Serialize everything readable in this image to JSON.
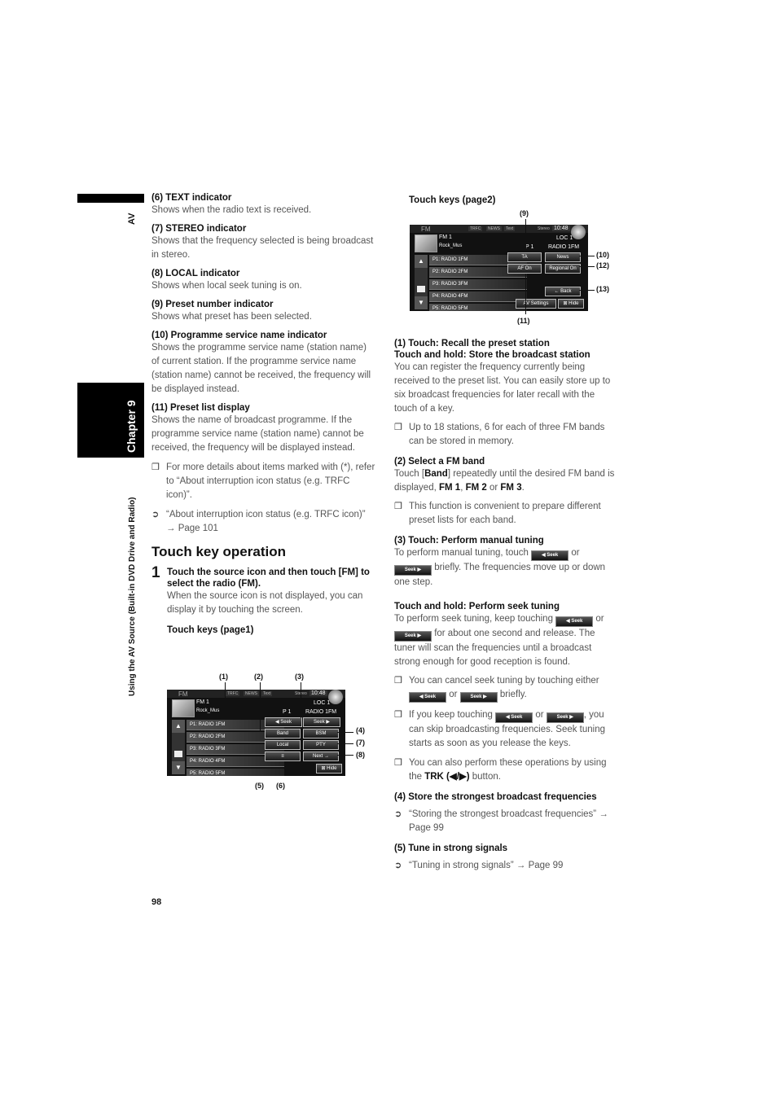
{
  "side": {
    "section_tab": "AV",
    "chapter": "Chapter 9",
    "running_title": "Using the AV Source (Built-in DVD Drive and Radio)"
  },
  "left": {
    "items": [
      {
        "heading": "(6) TEXT indicator",
        "body": "Shows when the radio text is received."
      },
      {
        "heading": "(7) STEREO indicator",
        "body": "Shows that the frequency selected is being broadcast in stereo."
      },
      {
        "heading": "(8) LOCAL indicator",
        "body": "Shows when local seek tuning is on."
      },
      {
        "heading": "(9) Preset number indicator",
        "body": "Shows what preset has been selected."
      },
      {
        "heading": "(10) Programme service name indicator",
        "body": "Shows the programme service name (station name) of current station. If the programme service name (station name) cannot be received, the frequency will be displayed instead."
      },
      {
        "heading": "(11) Preset list display",
        "body": "Shows the name of broadcast programme. If the programme service name (station name) cannot be received, the frequency will be displayed instead."
      }
    ],
    "note1": "For more details about items marked with (*), refer to “About interruption icon status (e.g. TRFC icon)”.",
    "ref1": "“About interruption icon status (e.g. TRFC icon)” → Page 101",
    "section_title": "Touch key operation",
    "step_num": "1",
    "step_heading": "Touch the source icon and then touch [FM] to select the radio (FM).",
    "step_body": "When the source icon is not displayed, you can display it by touching the screen.",
    "page1_label": "Touch keys (page1)"
  },
  "screen": {
    "source": "FM",
    "indicators": [
      "TRFC",
      "NEWS",
      "Text"
    ],
    "stereo": "Stereo",
    "clock": "10:48",
    "band": "FM 1",
    "ps_left": "Rock_Mus",
    "loc": "LOC 1",
    "preset_no": "P 1",
    "ps_name": "RADIO 1FM",
    "presets": [
      "P1: RADIO 1FM",
      "P2: RADIO 2FM",
      "P3: RADIO 3FM",
      "P4: RADIO 4FM",
      "P5: RADIO 5FM"
    ],
    "scroll_up": "▲",
    "scroll_down": "▼"
  },
  "page1": {
    "keys": {
      "seek_left": "◀ Seek",
      "seek_right": "Seek ▶",
      "band": "Band",
      "bsm": "BSM",
      "local": "Local",
      "pty": "PTY",
      "text": "≡",
      "next": "Next →",
      "hide": "⊠ Hide"
    },
    "callouts": {
      "c1": "(1)",
      "c2": "(2)",
      "c3": "(3)",
      "c4": "(4)",
      "c7": "(7)",
      "c8": "(8)",
      "c5": "(5)",
      "c6": "(6)"
    }
  },
  "page2": {
    "label": "Touch keys (page2)",
    "keys": {
      "ta": "TA",
      "news": "News",
      "af": "AF On",
      "regional": "Regional On",
      "back": "← Back",
      "av_settings": "AV Settings",
      "hide": "⊠ Hide"
    },
    "callouts": {
      "c9": "(9)",
      "c10": "(10)",
      "c12": "(12)",
      "c13": "(13)",
      "c11": "(11)"
    }
  },
  "right": {
    "s1_h1": "(1) Touch: Recall the preset station",
    "s1_h2": "Touch and hold: Store the broadcast station",
    "s1_body": "You can register the frequency currently being received to the preset list. You can easily store up to six broadcast frequencies for later recall with the touch of a key.",
    "s1_note": "Up to 18 stations, 6 for each of three FM bands can be stored in memory.",
    "s2_h": "(2) Select a FM band",
    "s2_pre": "Touch [",
    "s2_band": "Band",
    "s2_mid": "] repeatedly until the desired FM band is displayed, ",
    "s2_fm1": "FM 1",
    "s2_c1": ", ",
    "s2_fm2": "FM 2",
    "s2_or": " or ",
    "s2_fm3": "FM 3",
    "s2_end": ".",
    "s2_note": "This function is convenient to prepare different preset lists for each band.",
    "s3_h": "(3) Touch: Perform manual tuning",
    "s3_a": "To perform manual tuning, touch ",
    "s3_or": " or ",
    "s3_b": " briefly. The frequencies move up or down one step.",
    "s3b_h": "Touch and hold: Perform seek tuning",
    "s3b_a": "To perform seek tuning, keep touching ",
    "s3b_or": " or ",
    "s3b_b": " for about one second and release. The tuner will scan the frequencies until a broadcast strong enough for good reception is found.",
    "n1_a": "You can cancel seek tuning by touching either ",
    "n1_or": " or ",
    "n1_b": " briefly.",
    "n2_a": "If you keep touching ",
    "n2_or": " or ",
    "n2_b": ", you can skip broadcasting frequencies. Seek tuning starts as soon as you release the keys.",
    "n3_a": "You can also perform these operations by using the ",
    "n3_trk": "TRK (◀/▶)",
    "n3_b": " button.",
    "s4_h": "(4) Store the strongest broadcast frequencies",
    "s4_ref": "“Storing the strongest broadcast frequencies” → Page 99",
    "s5_h": "(5) Tune in strong signals",
    "s5_ref": "“Tuning in strong signals” → Page 99",
    "seek_left_chip": "◀ Seek",
    "seek_right_chip": "Seek ▶"
  },
  "markers": {
    "note": "❒",
    "ref": "➲"
  },
  "footer": {
    "page_number": "98"
  }
}
